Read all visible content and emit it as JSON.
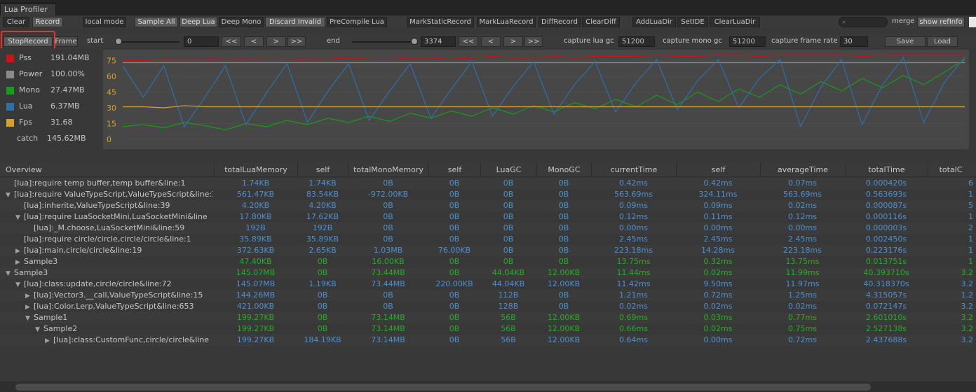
{
  "window": {
    "title": "Lua Profiler"
  },
  "toolbar1": {
    "clear": "Clear",
    "record": "Record",
    "local_mode": "local mode",
    "sample_all": "Sample All",
    "deep_lua": "Deep Lua",
    "deep_mono": "Deep Mono",
    "discard_invalid": "Discard Invalid",
    "precompile_lua": "PreCompile Lua",
    "mark_static": "MarkStaticRecord",
    "mark_lua": "MarkLuaRecord",
    "diff_record": "DiffRecord",
    "clear_diff": "ClearDiff",
    "add_lua_dir": "AddLuaDir",
    "set_ide": "SetIDE",
    "clear_lua_dir": "ClearLuaDir",
    "search_value": "",
    "merge": "merge",
    "show_ref_info": "show refInfo"
  },
  "toolbar2": {
    "stop_record": "StopRecord",
    "frame": "Frame",
    "start_label": "start",
    "start_value": "0",
    "start_position": 0,
    "prev_far": "<<",
    "prev": "<",
    "next": ">",
    "next_far": ">>",
    "end_label": "end",
    "end_value": "3374",
    "end_position": 1,
    "capture_lua_gc_label": "capture lua gc",
    "capture_lua_gc": "51200",
    "capture_mono_gc_label": "capture mono gc",
    "capture_mono_gc": "51200",
    "capture_frame_rate_label": "capture frame rate",
    "capture_frame_rate": "30",
    "save": "Save",
    "load": "Load"
  },
  "legend": [
    {
      "name": "Pss",
      "value": "191.04MB",
      "color": "#c81414"
    },
    {
      "name": "Power",
      "value": "100.00%",
      "color": "#8a8a8a"
    },
    {
      "name": "Mono",
      "value": "27.47MB",
      "color": "#1a9a1a"
    },
    {
      "name": "Lua",
      "value": "6.37MB",
      "color": "#2f6fa8"
    },
    {
      "name": "Fps",
      "value": "31.68",
      "color": "#d8a028"
    }
  ],
  "catch": {
    "label": "catch",
    "value": "145.62MB"
  },
  "chart_data": {
    "type": "line",
    "ylim": [
      0,
      80
    ],
    "y_ticks": [
      "75",
      "60",
      "45",
      "30",
      "15",
      "0"
    ],
    "series": [
      {
        "name": "Pss",
        "color": "#c81414",
        "values": [
          75,
          75,
          76,
          76,
          76,
          77,
          76,
          77,
          77,
          76,
          77,
          78,
          77,
          77,
          78,
          78,
          77,
          78,
          79,
          78,
          78,
          79,
          78,
          79,
          79,
          79,
          80,
          79,
          79,
          80,
          80,
          79,
          80,
          80,
          80,
          80,
          79,
          80,
          80,
          80,
          80,
          80
        ]
      },
      {
        "name": "Power",
        "color": "#8a8a8a",
        "values": [
          73,
          73,
          73,
          73,
          73,
          73,
          73,
          73,
          73,
          73,
          73,
          73,
          73,
          73,
          73,
          73,
          73,
          73,
          73,
          73,
          73,
          73,
          73,
          73,
          73,
          73,
          73,
          73,
          73,
          73,
          73,
          73,
          73,
          73,
          73,
          73,
          73,
          73,
          73,
          73,
          73,
          73
        ]
      },
      {
        "name": "Mono",
        "color": "#1a9a1a",
        "values": [
          12,
          14,
          11,
          16,
          13,
          9,
          15,
          12,
          18,
          14,
          20,
          16,
          22,
          17,
          25,
          20,
          27,
          22,
          30,
          24,
          32,
          26,
          35,
          29,
          38,
          31,
          42,
          33,
          45,
          36,
          48,
          40,
          52,
          43,
          55,
          46,
          58,
          49,
          61,
          52,
          64,
          76
        ]
      },
      {
        "name": "Lua",
        "color": "#2f6fa8",
        "values": [
          70,
          40,
          70,
          12,
          40,
          70,
          14,
          44,
          72,
          16,
          46,
          72,
          18,
          46,
          72,
          20,
          48,
          74,
          22,
          50,
          74,
          24,
          52,
          74,
          26,
          54,
          76,
          28,
          56,
          76,
          30,
          58,
          76,
          12,
          50,
          76,
          14,
          52,
          78,
          16,
          54,
          78
        ]
      },
      {
        "name": "Fps",
        "color": "#d8a028",
        "values": [
          31,
          31,
          30,
          32,
          31,
          31,
          31,
          31,
          31,
          31,
          31,
          31,
          31,
          31,
          31,
          31,
          31,
          31,
          31,
          31,
          31,
          31,
          31,
          31,
          31,
          31,
          31,
          31,
          31,
          31,
          31,
          31,
          31,
          31,
          31,
          31,
          31,
          31,
          31,
          31,
          31,
          31
        ]
      }
    ]
  },
  "columns": [
    "Overview",
    "totalLuaMemory",
    "self",
    "totalMonoMemory",
    "self",
    "LuaGC",
    "MonoGC",
    "currentTime",
    "self",
    "averageTime",
    "totalTime",
    "totalC"
  ],
  "rows": [
    {
      "indent": 0,
      "arrow": "",
      "name": "[lua]:require temp buffer,temp buffer&line:1",
      "color": "blue",
      "cells": [
        "1.74KB",
        "1.74KB",
        "0B",
        "0B",
        "0B",
        "0B",
        "0.42ms",
        "0.42ms",
        "0.07ms",
        "0.000420s",
        "6"
      ]
    },
    {
      "indent": 0,
      "arrow": "▼",
      "name": "[lua]:require ValueTypeScript,ValueTypeScript&line:1",
      "color": "blue",
      "cells": [
        "561.47KB",
        "83.54KB",
        "-972.00KB",
        "0B",
        "0B",
        "0B",
        "563.69ms",
        "324.11ms",
        "563.69ms",
        "0.563693s",
        "1"
      ]
    },
    {
      "indent": 1,
      "arrow": "",
      "name": "[lua]:inherite,ValueTypeScript&line:39",
      "color": "blue",
      "cells": [
        "4.20KB",
        "4.20KB",
        "0B",
        "0B",
        "0B",
        "0B",
        "0.09ms",
        "0.09ms",
        "0.02ms",
        "0.000087s",
        "5"
      ]
    },
    {
      "indent": 1,
      "arrow": "▼",
      "name": "[lua]:require LuaSocketMini,LuaSocketMini&line",
      "color": "blue",
      "cells": [
        "17.80KB",
        "17.62KB",
        "0B",
        "0B",
        "0B",
        "0B",
        "0.12ms",
        "0.11ms",
        "0.12ms",
        "0.000116s",
        "1"
      ]
    },
    {
      "indent": 2,
      "arrow": "",
      "name": "[lua]:_M.choose,LuaSocketMini&line:59",
      "color": "blue",
      "cells": [
        "192B",
        "192B",
        "0B",
        "0B",
        "0B",
        "0B",
        "0.00ms",
        "0.00ms",
        "0.00ms",
        "0.000003s",
        "2"
      ]
    },
    {
      "indent": 1,
      "arrow": "",
      "name": "[lua]:require circle/circle,circle/circle&line:1",
      "color": "blue",
      "cells": [
        "35.89KB",
        "35.89KB",
        "0B",
        "0B",
        "0B",
        "0B",
        "2.45ms",
        "2.45ms",
        "2.45ms",
        "0.002450s",
        "1"
      ]
    },
    {
      "indent": 1,
      "arrow": "▶",
      "name": "[lua]:main,circle/circle&line:19",
      "color": "blue",
      "cells": [
        "372.63KB",
        "2.65KB",
        "1.03MB",
        "76.00KB",
        "0B",
        "0B",
        "223.18ms",
        "14.28ms",
        "223.18ms",
        "0.223176s",
        "1"
      ]
    },
    {
      "indent": 1,
      "arrow": "▶",
      "name": "Sample3",
      "color": "green",
      "cells": [
        "47.40KB",
        "0B",
        "16.00KB",
        "0B",
        "0B",
        "0B",
        "13.75ms",
        "0.32ms",
        "13.75ms",
        "0.013751s",
        "1"
      ]
    },
    {
      "indent": 0,
      "arrow": "▼",
      "name": "Sample3",
      "color": "green",
      "cells": [
        "145.07MB",
        "0B",
        "73.44MB",
        "0B",
        "44.04KB",
        "12.00KB",
        "11.44ms",
        "0.02ms",
        "11.99ms",
        "40.393710s",
        "3.2"
      ]
    },
    {
      "indent": 1,
      "arrow": "▼",
      "name": "[lua]:class:update,circle/circle&line:72",
      "color": "blue",
      "cells": [
        "145.07MB",
        "1.19KB",
        "73.44MB",
        "220.00KB",
        "44.04KB",
        "12.00KB",
        "11.42ms",
        "9.50ms",
        "11.97ms",
        "40.318370s",
        "3.2"
      ]
    },
    {
      "indent": 2,
      "arrow": "▶",
      "name": "[lua]:Vector3.__call,ValueTypeScript&line:15",
      "color": "blue",
      "cells": [
        "144.26MB",
        "0B",
        "0B",
        "0B",
        "112B",
        "0B",
        "1.21ms",
        "0.72ms",
        "1.25ms",
        "4.315057s",
        "1.2"
      ]
    },
    {
      "indent": 2,
      "arrow": "▶",
      "name": "[lua]:Color.Lerp,ValueTypeScript&line:653",
      "color": "blue",
      "cells": [
        "421.00KB",
        "0B",
        "0B",
        "0B",
        "128B",
        "0B",
        "0.02ms",
        "0.02ms",
        "0.02ms",
        "0.072147s",
        "3.2"
      ]
    },
    {
      "indent": 2,
      "arrow": "▼",
      "name": "Sample1",
      "color": "green",
      "cells": [
        "199.27KB",
        "0B",
        "73.14MB",
        "0B",
        "56B",
        "12.00KB",
        "0.69ms",
        "0.03ms",
        "0.77ms",
        "2.601010s",
        "3.2"
      ]
    },
    {
      "indent": 3,
      "arrow": "▼",
      "name": "Sample2",
      "color": "green",
      "cells": [
        "199.27KB",
        "0B",
        "73.14MB",
        "0B",
        "56B",
        "12.00KB",
        "0.66ms",
        "0.02ms",
        "0.75ms",
        "2.527138s",
        "3.2"
      ]
    },
    {
      "indent": 4,
      "arrow": "▶",
      "name": "[lua]:class:CustomFunc,circle/circle&line",
      "color": "blue",
      "cells": [
        "199.27KB",
        "184.19KB",
        "73.14MB",
        "0B",
        "56B",
        "12.00KB",
        "0.64ms",
        "0.00ms",
        "0.72ms",
        "2.437688s",
        "3.2"
      ]
    }
  ]
}
